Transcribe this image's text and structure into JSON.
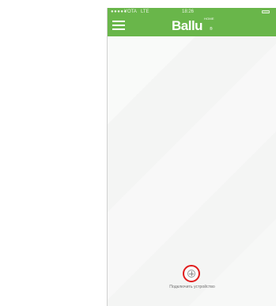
{
  "status_bar": {
    "signal_dots": "●●●●●",
    "carrier": "YOTA",
    "network": "LTE",
    "time": "18:26",
    "battery_icon": "battery-icon"
  },
  "header": {
    "menu_icon": "hamburger-menu-icon",
    "brand": "Ballu",
    "brand_home": "HOME",
    "brand_mark": "®",
    "accent_color": "#69b64a"
  },
  "main": {
    "add_device_icon": "plus-circle-icon",
    "add_device_label": "Подключить устройство",
    "highlight_color": "#e11d1d"
  }
}
